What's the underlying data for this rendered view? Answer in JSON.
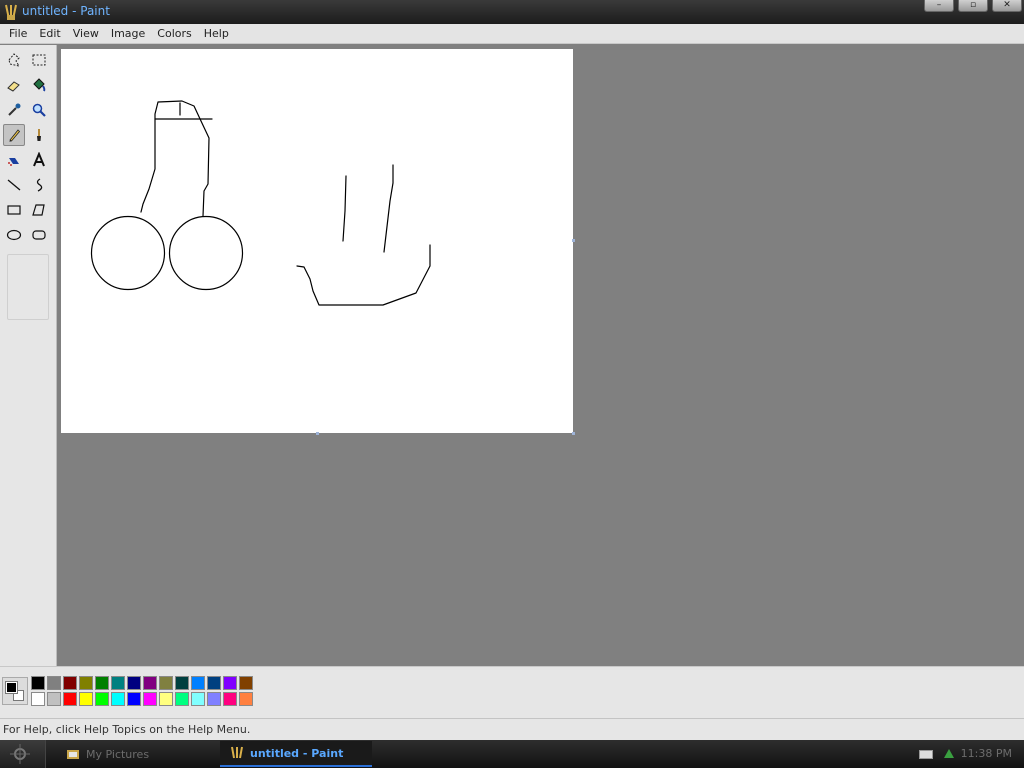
{
  "window": {
    "title": "untitled - Paint",
    "buttons": [
      "–",
      "▫",
      "✕"
    ]
  },
  "menu": [
    "File",
    "Edit",
    "View",
    "Image",
    "Colors",
    "Help"
  ],
  "toolbox": {
    "selected_tool": "pencil",
    "tools": [
      "free-form-select",
      "select",
      "eraser",
      "fill-with-color",
      "pick-color",
      "magnifier",
      "pencil",
      "brush",
      "airbrush",
      "text",
      "line",
      "curve",
      "rectangle",
      "polygon",
      "ellipse",
      "rounded-rectangle"
    ]
  },
  "palette": {
    "foreground": "#000000",
    "background": "#ffffff",
    "row1": [
      "#000000",
      "#808080",
      "#800000",
      "#808000",
      "#008000",
      "#008080",
      "#000080",
      "#800080",
      "#808040",
      "#004040",
      "#0080ff",
      "#004080",
      "#8000ff",
      "#804000"
    ],
    "row2": [
      "#ffffff",
      "#c0c0c0",
      "#ff0000",
      "#ffff00",
      "#00ff00",
      "#00ffff",
      "#0000ff",
      "#ff00ff",
      "#ffff80",
      "#00ff80",
      "#80ffff",
      "#8080ff",
      "#ff0080",
      "#ff8040"
    ]
  },
  "status": {
    "help_text": "For Help, click Help Topics on the Help Menu."
  },
  "taskbar": {
    "tasks": [
      "My Pictures",
      "untitled - Paint"
    ],
    "clock": "11:38 PM"
  }
}
